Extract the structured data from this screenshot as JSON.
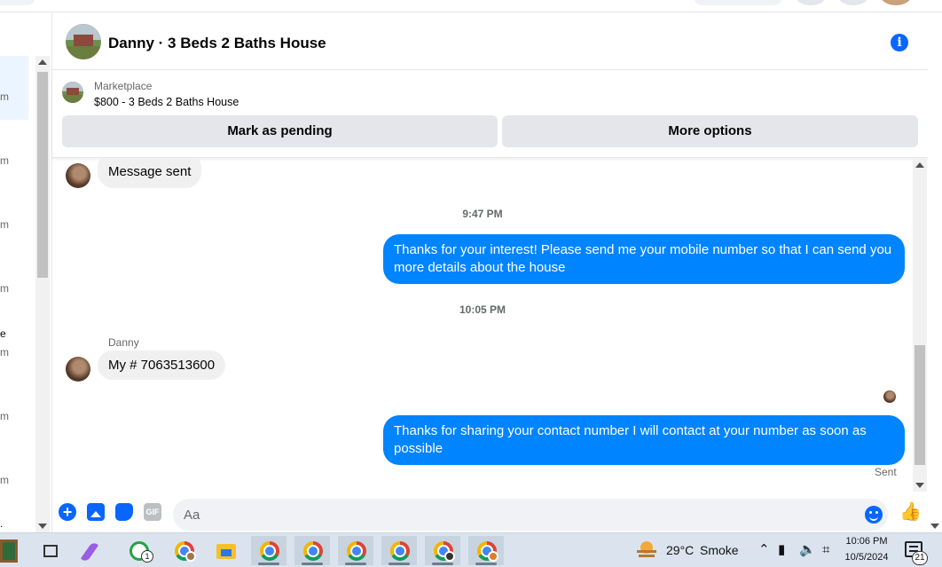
{
  "sidebar": {
    "slices": [
      "m",
      "m",
      "m",
      "m",
      "e",
      "m",
      "m",
      "m",
      "."
    ]
  },
  "chat": {
    "title": "Danny · 3 Beds 2 Baths House",
    "marketplace": {
      "label": "Marketplace",
      "listing": "$800 - 3 Beds 2 Baths House",
      "mark_pending": "Mark as pending",
      "more_options": "More options"
    },
    "messages": {
      "first_in": "Message sent",
      "ts1": "9:47 PM",
      "out1": "Thanks for your interest! Please send me your mobile number so that I can send you more details about the house",
      "ts2": "10:05 PM",
      "sender": "Danny",
      "in2": "My # 7063513600",
      "out2": "Thanks for sharing your contact number I will contact at your number as soon as possible",
      "status": "Sent"
    },
    "composer": {
      "placeholder": "Aa",
      "gif": "GIF"
    }
  },
  "taskbar": {
    "whatsapp_badge": "1",
    "weather_temp": "29°C",
    "weather_desc": "Smoke",
    "time": "10:06 PM",
    "date": "10/5/2024",
    "notifications": "21"
  },
  "colors": {
    "accent": "#0866ff",
    "outgoing_bubble": "#0084ff",
    "incoming_bubble": "#f0f0f0"
  }
}
